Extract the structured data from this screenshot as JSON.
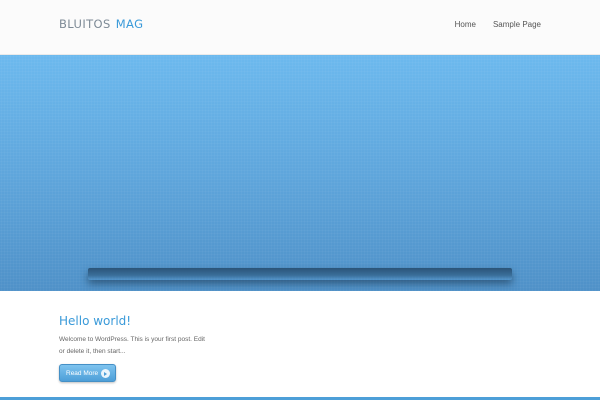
{
  "site": {
    "logo_primary": "BLUITOS",
    "logo_accent": "MAG"
  },
  "nav": {
    "items": [
      {
        "label": "Home"
      },
      {
        "label": "Sample Page"
      }
    ]
  },
  "post": {
    "title": "Hello world!",
    "excerpt": "Welcome to WordPress. This is your first post. Edit or delete it, then start...",
    "read_more_label": "Read More"
  },
  "colors": {
    "accent": "#3a9ad9",
    "hero_top": "#6cb9ee",
    "hero_bottom": "#4f91c8"
  },
  "icons": {
    "read_more_icon": "arrow-right-circle-icon"
  }
}
